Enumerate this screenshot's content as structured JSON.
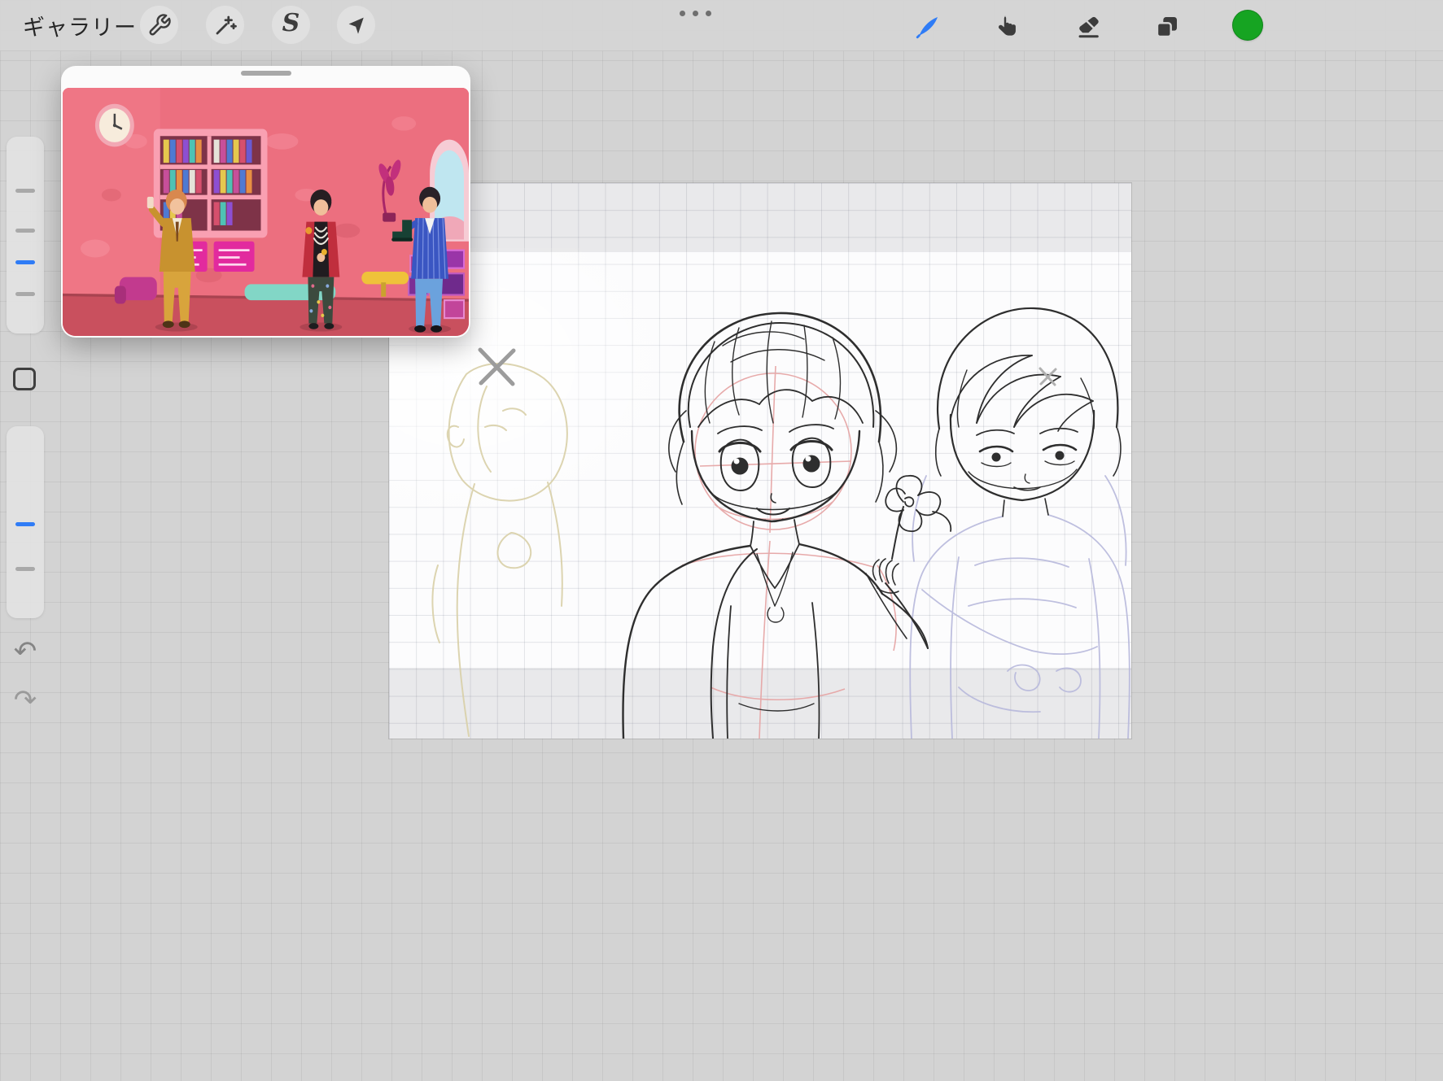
{
  "toolbar": {
    "gallery_label": "ギャラリー",
    "selection_glyph": "S",
    "left_tools": [
      {
        "name": "actions",
        "icon": "wrench-icon"
      },
      {
        "name": "adjustments",
        "icon": "magic-wand-icon"
      },
      {
        "name": "selection",
        "icon": "selection-s-icon"
      },
      {
        "name": "transform",
        "icon": "transform-arrow-icon"
      }
    ],
    "right_tools": [
      {
        "name": "paint",
        "icon": "paint-brush-icon",
        "active": true
      },
      {
        "name": "smudge",
        "icon": "smudge-finger-icon",
        "active": false
      },
      {
        "name": "erase",
        "icon": "eraser-icon",
        "active": false
      },
      {
        "name": "layers",
        "icon": "layers-icon",
        "active": false
      },
      {
        "name": "color",
        "icon": "color-swatch",
        "active": false
      }
    ],
    "active_tool_color": "#2f7cf6",
    "color_swatch": "#16a422"
  },
  "sidebar": {
    "undo_glyph": "↶",
    "redo_glyph": "↷",
    "top_slider_ticks": [
      "gray",
      "gray",
      "blue",
      "gray"
    ],
    "bottom_slider_ticks": [
      "blue",
      "gray"
    ],
    "accent_blue": "#2f7cf6"
  },
  "reference_window": {
    "kind": "reference-image"
  },
  "canvas": {
    "kind": "sketch-canvas"
  }
}
